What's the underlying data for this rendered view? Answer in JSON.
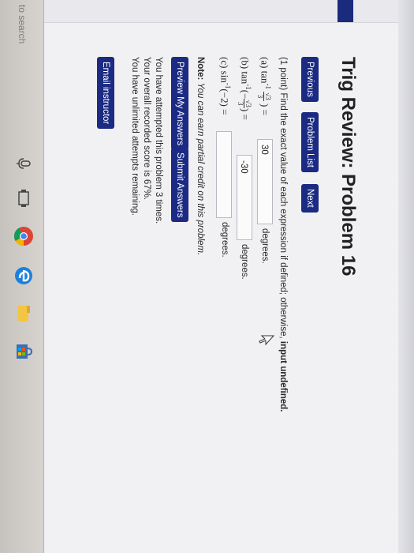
{
  "title": "Trig Review: Problem 16",
  "nav": {
    "previous": "Previous",
    "problem_list": "Problem List",
    "next": "Next"
  },
  "problem": {
    "prompt_normal": "(1 point) Find the exact value of each expression if defined; otherwise, ",
    "prompt_bold": "input undefined.",
    "parts": [
      {
        "label": "(a) tan",
        "sup": "-1",
        "frac_num": "√3",
        "frac_den": "3",
        "suffix": ") =",
        "value": "30",
        "unit": "degrees."
      },
      {
        "label": "(b) tan",
        "sup": "-1",
        "mid": "(−",
        "frac_num": "√3",
        "frac_den": "3",
        "suffix": ") =",
        "value": "-30",
        "unit": "degrees."
      },
      {
        "label": "(c) sin",
        "sup": "-1",
        "mid": "(−2) =",
        "value": "",
        "unit": "degrees."
      }
    ]
  },
  "note_label": "Note:",
  "note_text": "You can earn partial credit on this problem.",
  "buttons": {
    "preview": "Preview My Answers",
    "submit": "Submit Answers",
    "email": "Email instructor"
  },
  "status": [
    "You have attempted this problem 3 times.",
    "Your overall recorded score is 67%.",
    "You have unlimited attempts remaining."
  ],
  "taskbar": {
    "search_text": "to search"
  },
  "colors": {
    "accent": "#1b2a82",
    "taskbar": "#d0cdc9"
  }
}
